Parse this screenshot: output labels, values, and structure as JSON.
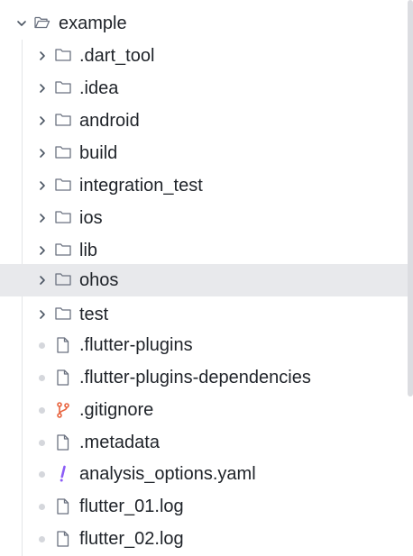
{
  "tree": {
    "root": {
      "label": "example",
      "icon": "folder-open-icon",
      "expanded": true
    },
    "items": [
      {
        "label": ".dart_tool",
        "kind": "folder",
        "icon": "folder-icon"
      },
      {
        "label": ".idea",
        "kind": "folder",
        "icon": "folder-icon"
      },
      {
        "label": "android",
        "kind": "folder",
        "icon": "folder-icon"
      },
      {
        "label": "build",
        "kind": "folder",
        "icon": "folder-icon"
      },
      {
        "label": "integration_test",
        "kind": "folder",
        "icon": "folder-icon"
      },
      {
        "label": "ios",
        "kind": "folder",
        "icon": "folder-icon"
      },
      {
        "label": "lib",
        "kind": "folder",
        "icon": "folder-icon"
      },
      {
        "label": "ohos",
        "kind": "folder",
        "icon": "folder-icon",
        "selected": true
      },
      {
        "label": "test",
        "kind": "folder",
        "icon": "folder-icon"
      },
      {
        "label": ".flutter-plugins",
        "kind": "file",
        "icon": "file-icon"
      },
      {
        "label": ".flutter-plugins-dependencies",
        "kind": "file",
        "icon": "file-icon"
      },
      {
        "label": ".gitignore",
        "kind": "file",
        "icon": "git-branch-icon"
      },
      {
        "label": ".metadata",
        "kind": "file",
        "icon": "file-icon"
      },
      {
        "label": "analysis_options.yaml",
        "kind": "file",
        "icon": "exclamation-icon"
      },
      {
        "label": "flutter_01.log",
        "kind": "file",
        "icon": "file-icon"
      },
      {
        "label": "flutter_02.log",
        "kind": "file",
        "icon": "file-icon"
      }
    ]
  },
  "colors": {
    "text": "#1f2329",
    "icon": "#6b7280",
    "selected_bg": "#e8e9ec",
    "git_icon": "#e8643f",
    "yaml_icon": "#8b5cf6"
  }
}
